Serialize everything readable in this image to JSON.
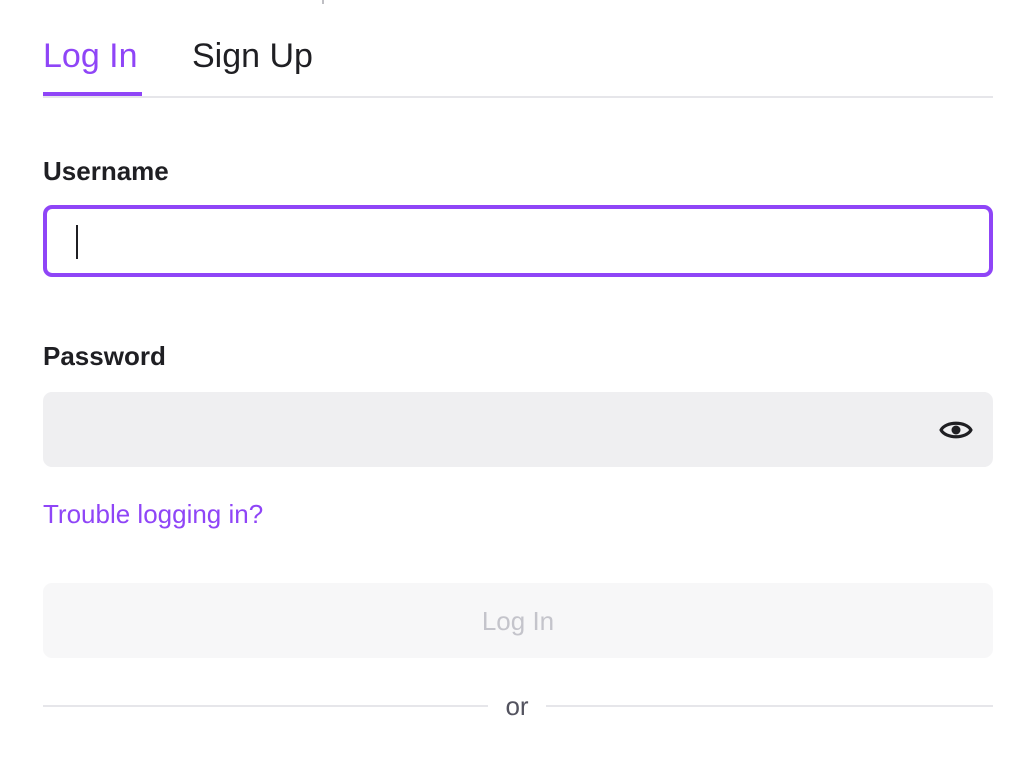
{
  "tabs": [
    {
      "label": "Log In",
      "active": true
    },
    {
      "label": "Sign Up",
      "active": false
    }
  ],
  "form": {
    "username": {
      "label": "Username",
      "value": "",
      "placeholder": "",
      "focused": true
    },
    "password": {
      "label": "Password",
      "value": "",
      "placeholder": "",
      "toggle_icon": "eye-icon"
    },
    "trouble_link": "Trouble logging in?",
    "submit_label": "Log In",
    "submit_disabled": true,
    "divider_text": "or"
  },
  "colors": {
    "accent": "#8f45f7",
    "text": "#1f1f23",
    "input_bg": "#efeff1",
    "disabled_bg": "#f7f7f8",
    "disabled_text": "#c4c4cb",
    "divider": "#e6e6ea"
  }
}
